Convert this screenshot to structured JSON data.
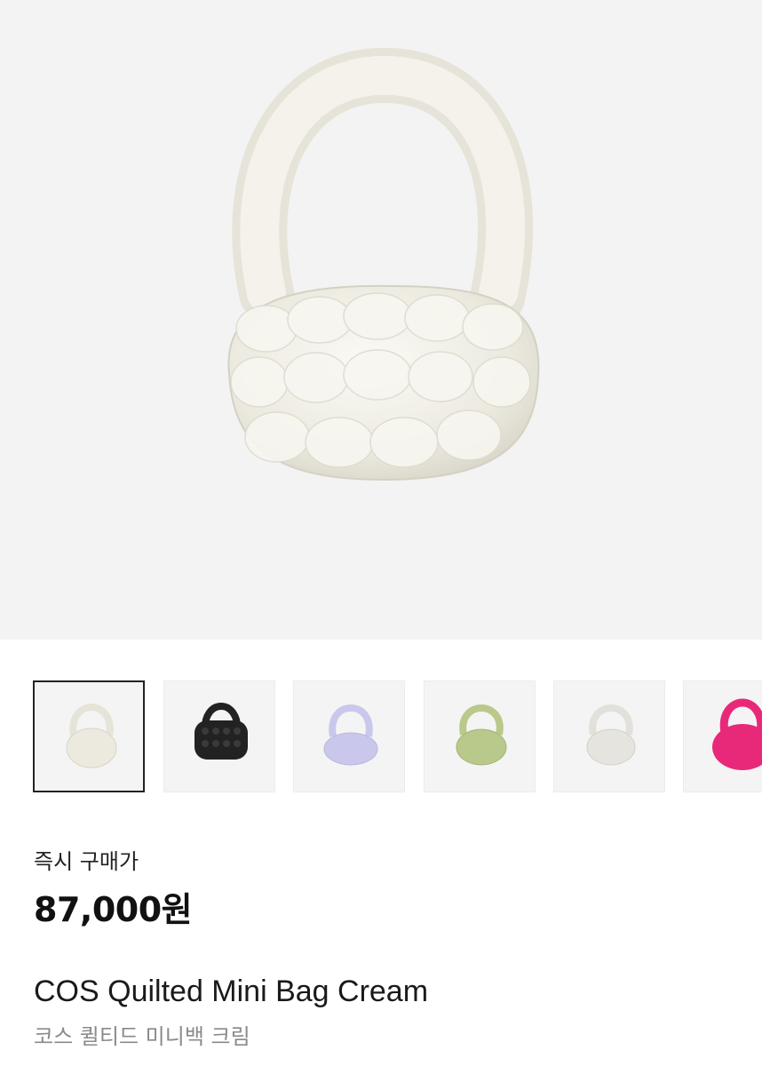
{
  "product": {
    "main_image": "cream-quilted-bag",
    "thumbnails": [
      {
        "name": "thumb-cream",
        "color": "#ece9df",
        "selected": true
      },
      {
        "name": "thumb-black",
        "color": "#222222",
        "selected": false
      },
      {
        "name": "thumb-lilac",
        "color": "#c9c8ec",
        "selected": false
      },
      {
        "name": "thumb-green",
        "color": "#b9c98b",
        "selected": false
      },
      {
        "name": "thumb-cream-2",
        "color": "#e6e4de",
        "selected": false
      },
      {
        "name": "thumb-pink",
        "color": "#e8297a",
        "selected": false
      }
    ],
    "price_label": "즉시 구매가",
    "price": "87,000원",
    "title": "COS Quilted Mini Bag Cream",
    "subtitle": "코스 퀼티드 미니백 크림"
  }
}
